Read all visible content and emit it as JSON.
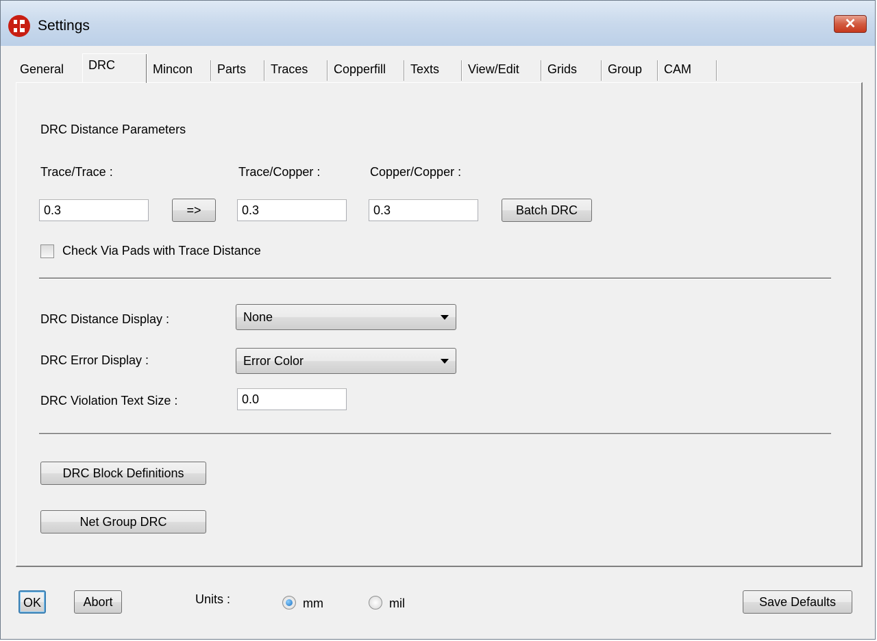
{
  "window": {
    "title": "Settings",
    "close_glyph": "✕"
  },
  "tabs": [
    {
      "label": "General",
      "active": false
    },
    {
      "label": "DRC",
      "active": true
    },
    {
      "label": "Mincon",
      "active": false
    },
    {
      "label": "Parts",
      "active": false
    },
    {
      "label": "Traces",
      "active": false
    },
    {
      "label": "Copperfill",
      "active": false
    },
    {
      "label": "Texts",
      "active": false
    },
    {
      "label": "View/Edit",
      "active": false
    },
    {
      "label": "Grids",
      "active": false
    },
    {
      "label": "Group",
      "active": false
    },
    {
      "label": "CAM",
      "active": false
    }
  ],
  "drc": {
    "section_title": "DRC Distance Parameters",
    "trace_trace": {
      "label": "Trace/Trace :",
      "value": "0.3"
    },
    "copy_button": "=>",
    "trace_copper": {
      "label": "Trace/Copper :",
      "value": "0.3"
    },
    "copper_copper": {
      "label": "Copper/Copper :",
      "value": "0.3"
    },
    "batch_button": "Batch DRC",
    "via_check": {
      "label": "Check Via Pads with Trace Distance",
      "checked": false
    },
    "distance_display": {
      "label": "DRC Distance Display :",
      "value": "None"
    },
    "error_display": {
      "label": "DRC Error Display :",
      "value": "Error Color"
    },
    "violation_text_size": {
      "label": "DRC Violation Text Size :",
      "value": "0.0"
    },
    "block_definitions_button": "DRC Block Definitions",
    "net_group_button": "Net Group DRC"
  },
  "footer": {
    "ok": "OK",
    "abort": "Abort",
    "units_label": "Units :",
    "unit_options": [
      {
        "label": "mm",
        "selected": true
      },
      {
        "label": "mil",
        "selected": false
      }
    ],
    "save_defaults": "Save Defaults"
  },
  "icons": {
    "app": "app-logo-icon",
    "close": "close-icon",
    "dropdown": "chevron-down-icon"
  }
}
